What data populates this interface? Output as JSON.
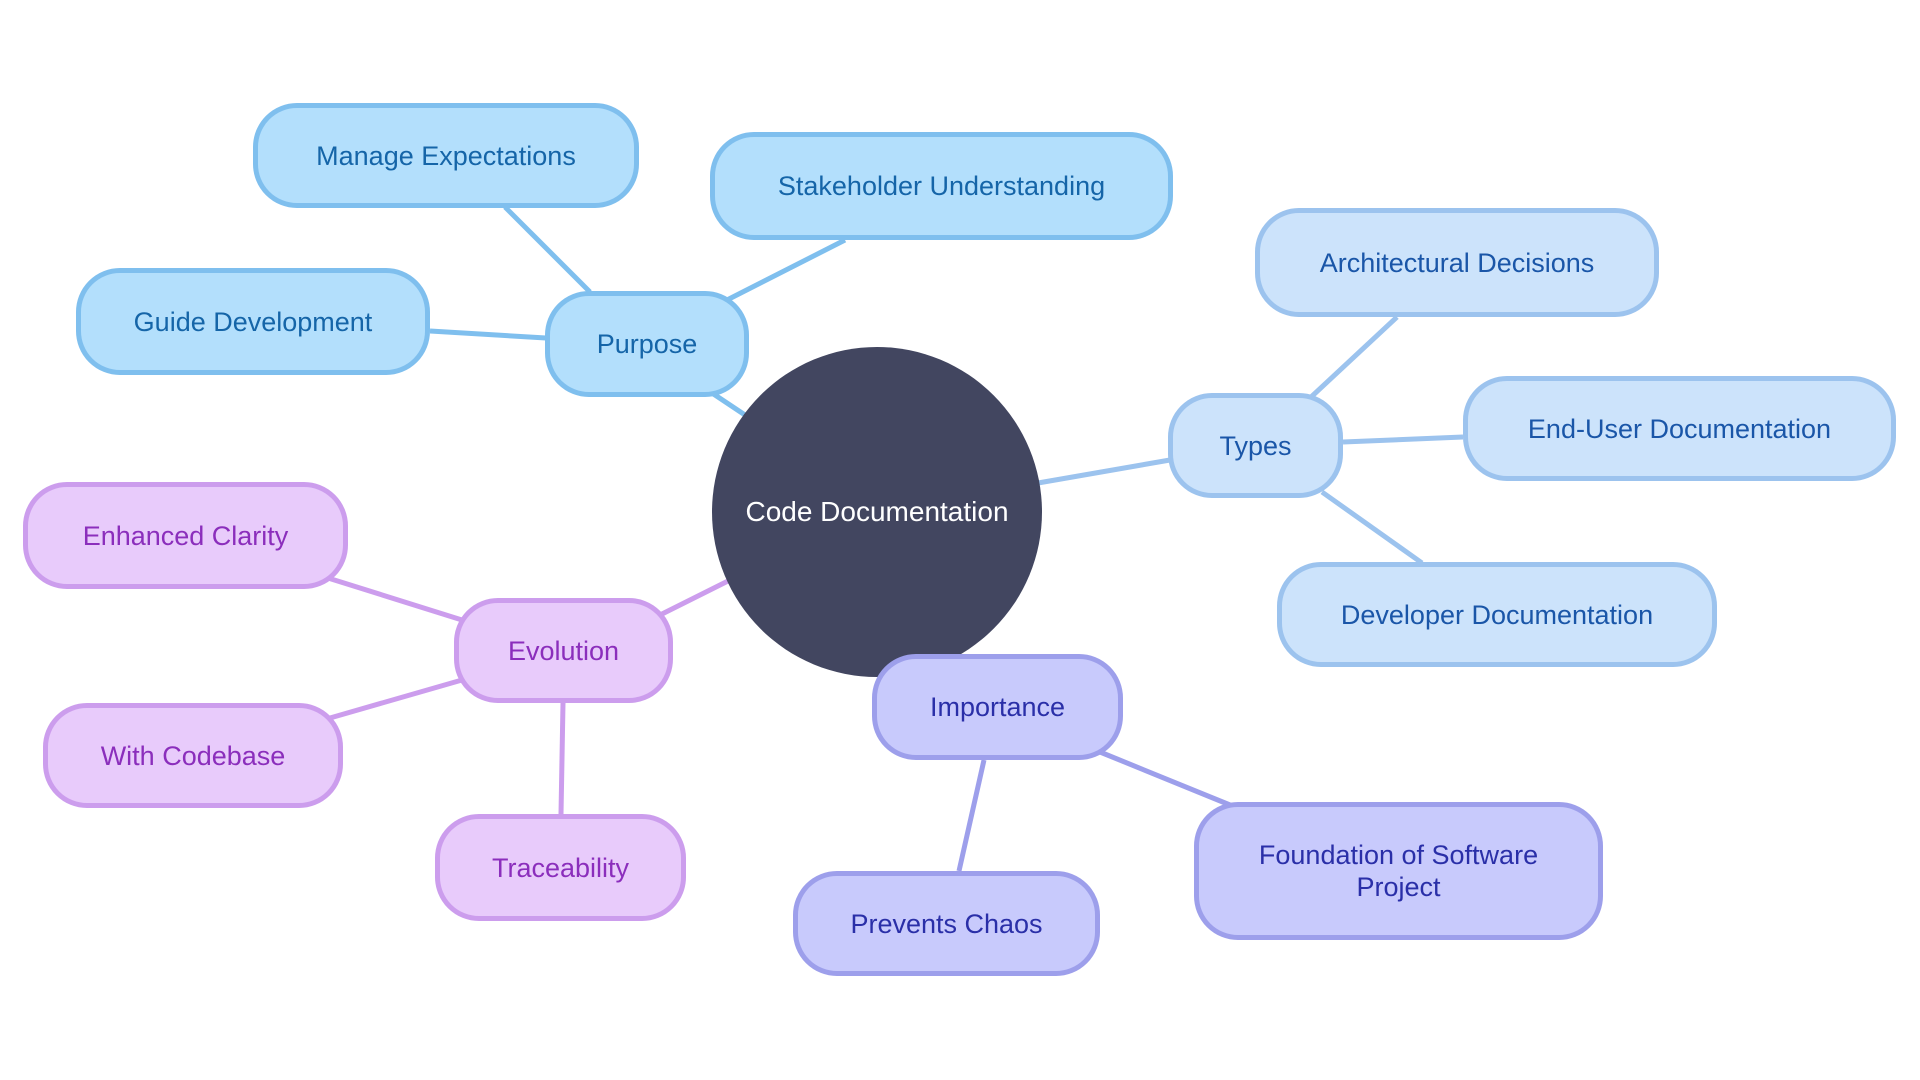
{
  "diagram": {
    "type": "mindmap",
    "root": {
      "label": "Code Documentation",
      "color": "#424660"
    },
    "branches": [
      {
        "label": "Purpose",
        "colors": {
          "fill": "#b3dffc",
          "border": "#7fbfee",
          "text": "#1565a8"
        },
        "children": [
          "Manage Expectations",
          "Stakeholder Understanding",
          "Guide Development"
        ]
      },
      {
        "label": "Types",
        "colors": {
          "fill": "#cce3fb",
          "border": "#9cc3ee",
          "text": "#1a56a8"
        },
        "children": [
          "Architectural Decisions",
          "End-User Documentation",
          "Developer Documentation"
        ]
      },
      {
        "label": "Evolution",
        "colors": {
          "fill": "#e8cbfb",
          "border": "#cc9ded",
          "text": "#8b2ebc"
        },
        "children": [
          "Enhanced Clarity",
          "With Codebase",
          "Traceability"
        ]
      },
      {
        "label": "Importance",
        "colors": {
          "fill": "#c8cafc",
          "border": "#9d9feb",
          "text": "#2a2fa8"
        },
        "children": [
          "Prevents Chaos",
          "Foundation of Software Project"
        ]
      }
    ]
  }
}
